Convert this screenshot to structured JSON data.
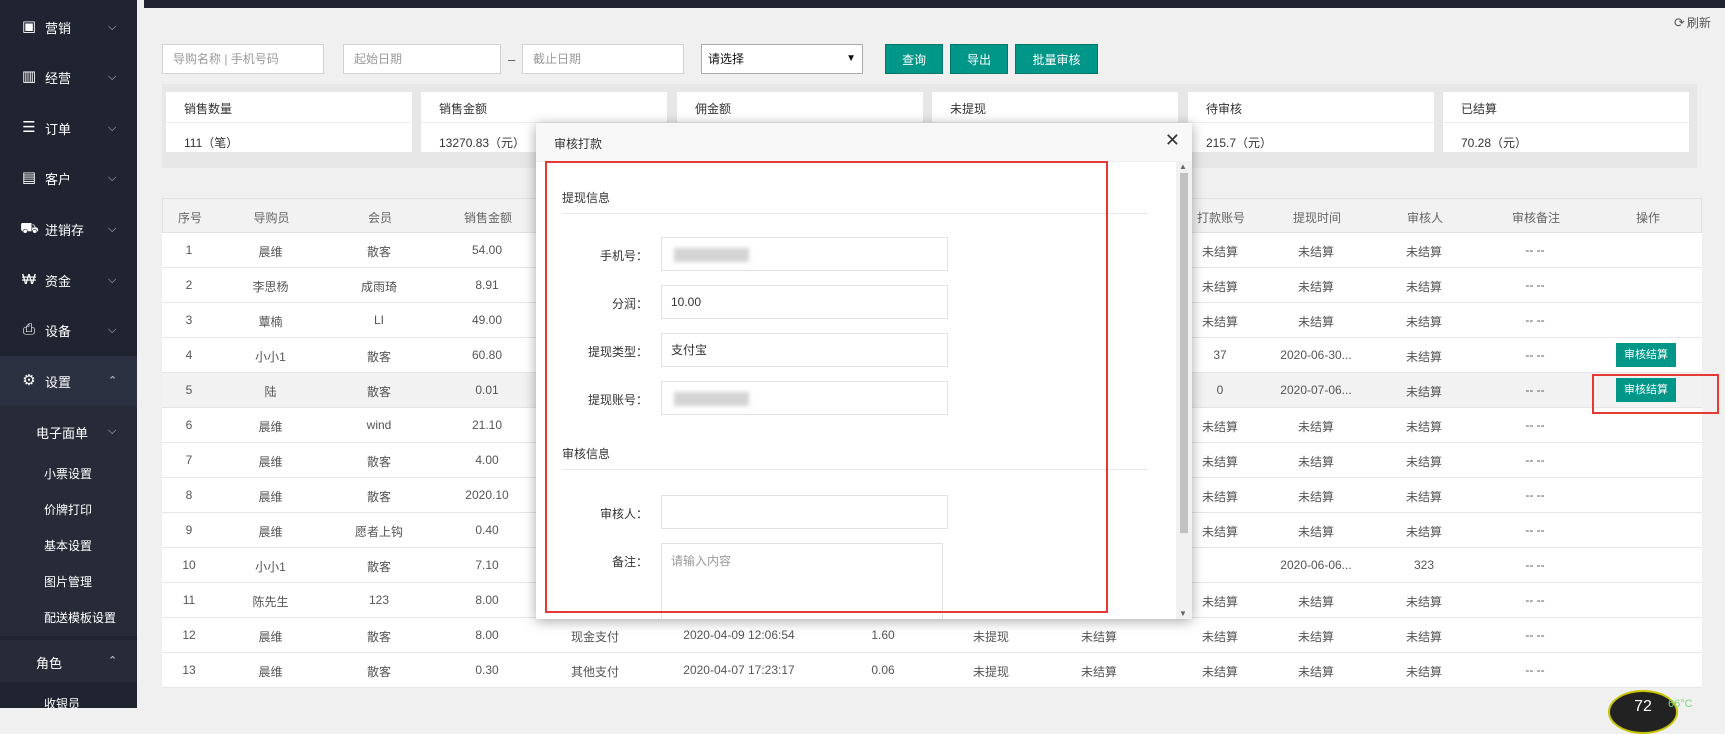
{
  "sidebar": {
    "items": [
      {
        "label": "营销",
        "icon": "gift-icon",
        "glyph": "🎁"
      },
      {
        "label": "经营",
        "icon": "bar-chart-icon",
        "glyph": "📊"
      },
      {
        "label": "订单",
        "icon": "list-icon",
        "glyph": "☰"
      },
      {
        "label": "客户",
        "icon": "id-card-icon",
        "glyph": "🪪"
      },
      {
        "label": "进销存",
        "icon": "truck-icon",
        "glyph": "🚚"
      },
      {
        "label": "资金",
        "icon": "currency-icon",
        "glyph": "₩"
      },
      {
        "label": "设备",
        "icon": "printer-icon",
        "glyph": "🖨"
      },
      {
        "label": "设置",
        "icon": "gear-icon",
        "glyph": "⚙"
      }
    ],
    "sub_group": {
      "label": "电子面单"
    },
    "sub_items": [
      "小票设置",
      "价牌打印",
      "基本设置",
      "图片管理",
      "配送模板设置"
    ],
    "role_group": {
      "label": "角色"
    },
    "role_items": [
      "收银员"
    ]
  },
  "header": {
    "refresh_label": "刷新"
  },
  "search": {
    "name_placeholder": "导购名称 | 手机号码",
    "start_placeholder": "起始日期",
    "end_placeholder": "截止日期",
    "range_separator": "–",
    "select_value": "请选择",
    "query_label": "查询",
    "export_label": "导出",
    "batch_label": "批量审核"
  },
  "stats": [
    {
      "title": "销售数量",
      "value": "111（笔）"
    },
    {
      "title": "销售金额",
      "value": "13270.83（元）"
    },
    {
      "title": "佣金额",
      "value": ""
    },
    {
      "title": "未提现",
      "value": ""
    },
    {
      "title": "待审核",
      "value": "215.7（元）"
    },
    {
      "title": "已结算",
      "value": "70.28（元）"
    }
  ],
  "table": {
    "headers_left": [
      "序号",
      "导购员",
      "会员",
      "销售金额"
    ],
    "headers_right": [
      "打款账号",
      "提现时间",
      "审核人",
      "审核备注",
      "操作"
    ],
    "rows": [
      {
        "no": "1",
        "guide": "晨维",
        "member": "散客",
        "amount": "54.00",
        "acct": "未结算",
        "time": "未结算",
        "auditor": "未结算",
        "remark": "-- --",
        "action": ""
      },
      {
        "no": "2",
        "guide": "李思杨",
        "member": "成雨琦",
        "amount": "8.91",
        "acct": "未结算",
        "time": "未结算",
        "auditor": "未结算",
        "remark": "-- --",
        "action": ""
      },
      {
        "no": "3",
        "guide": "蕈楠",
        "member": "LI",
        "amount": "49.00",
        "acct": "未结算",
        "time": "未结算",
        "auditor": "未结算",
        "remark": "-- --",
        "action": ""
      },
      {
        "no": "4",
        "guide": "小小1",
        "member": "散客",
        "amount": "60.80",
        "acct": "37",
        "time": "2020-06-30...",
        "auditor": "未结算",
        "remark": "-- --",
        "action": "审核结算"
      },
      {
        "no": "5",
        "guide": "陆",
        "member": "散客",
        "amount": "0.01",
        "acct": "0",
        "time": "2020-07-06...",
        "auditor": "未结算",
        "remark": "-- --",
        "action": "审核结算"
      },
      {
        "no": "6",
        "guide": "晨维",
        "member": "wind",
        "amount": "21.10",
        "acct": "未结算",
        "time": "未结算",
        "auditor": "未结算",
        "remark": "-- --",
        "action": ""
      },
      {
        "no": "7",
        "guide": "晨维",
        "member": "散客",
        "amount": "4.00",
        "acct": "未结算",
        "time": "未结算",
        "auditor": "未结算",
        "remark": "-- --",
        "action": ""
      },
      {
        "no": "8",
        "guide": "晨维",
        "member": "散客",
        "amount": "2020.10",
        "acct": "未结算",
        "time": "未结算",
        "auditor": "未结算",
        "remark": "-- --",
        "action": ""
      },
      {
        "no": "9",
        "guide": "晨维",
        "member": "愿者上钩",
        "amount": "0.40",
        "acct": "未结算",
        "time": "未结算",
        "auditor": "未结算",
        "remark": "-- --",
        "action": ""
      },
      {
        "no": "10",
        "guide": "小小1",
        "member": "散客",
        "amount": "7.10",
        "acct": "",
        "time": "2020-06-06...",
        "auditor": "323",
        "remark": "-- --",
        "action": ""
      },
      {
        "no": "11",
        "guide": "陈先生",
        "member": "123",
        "amount": "8.00",
        "acct": "未结算",
        "time": "未结算",
        "auditor": "未结算",
        "remark": "-- --",
        "action": ""
      },
      {
        "no": "12",
        "guide": "晨维",
        "member": "散客",
        "amount": "8.00",
        "pay": "现金支付",
        "date": "2020-04-09 12:06:54",
        "comm": "1.60",
        "status": "未提现",
        "settle": "未结算",
        "acct": "未结算",
        "time": "未结算",
        "auditor": "未结算",
        "remark": "-- --",
        "action": ""
      },
      {
        "no": "13",
        "guide": "晨维",
        "member": "散客",
        "amount": "0.30",
        "pay": "其他支付",
        "date": "2020-04-07 17:23:17",
        "comm": "0.06",
        "status": "未提现",
        "settle": "未结算",
        "acct": "未结算",
        "time": "未结算",
        "auditor": "未结算",
        "remark": "-- --",
        "action": ""
      }
    ]
  },
  "modal": {
    "title": "审核打款",
    "section_withdraw": "提现信息",
    "section_audit": "审核信息",
    "fields": [
      {
        "label": "手机号：",
        "value": ""
      },
      {
        "label": "分润：",
        "value": "10.00"
      },
      {
        "label": "提现类型：",
        "value": "支付宝"
      },
      {
        "label": "提现账号：",
        "value": ""
      }
    ],
    "auditor_label": "审核人：",
    "auditor_value": "",
    "remark_label": "备注：",
    "remark_placeholder": "请输入内容"
  },
  "widget": {
    "value": "72",
    "temp": "66°C"
  },
  "colors": {
    "sidebar": "#1f2430",
    "primary": "#009688",
    "annotation": "#e53935"
  }
}
